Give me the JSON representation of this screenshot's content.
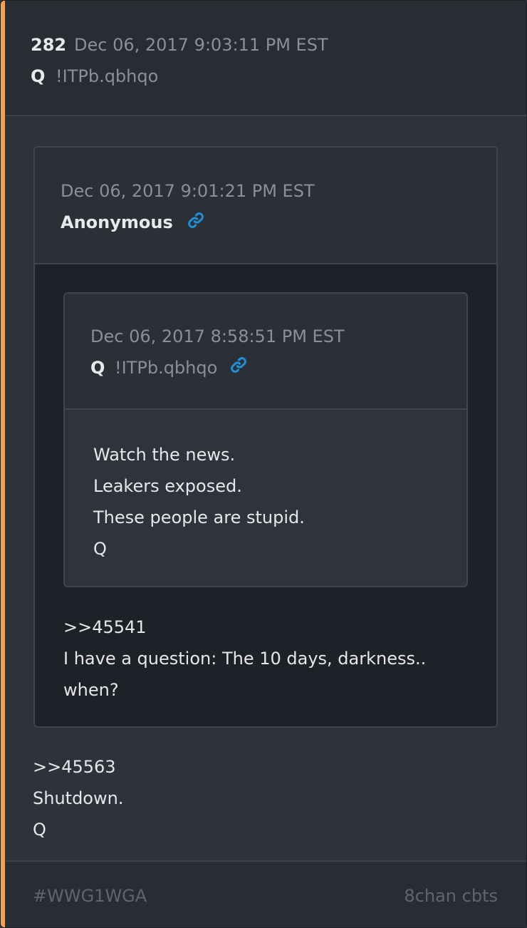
{
  "post": {
    "number": "282",
    "timestamp": "Dec 06, 2017 9:03:11 PM EST",
    "author": "Q",
    "tripcode": "!ITPb.qbhqo",
    "body_lines": [
      ">>45563",
      "Shutdown.",
      "Q"
    ]
  },
  "quoted": {
    "timestamp": "Dec 06, 2017 9:01:21 PM EST",
    "author": "Anonymous",
    "link_icon": "link-icon",
    "body_lines": [
      ">>45541",
      "I have a question: The 10 days, darkness..",
      "when?"
    ],
    "nested": {
      "timestamp": "Dec 06, 2017 8:58:51 PM EST",
      "author": "Q",
      "tripcode": "!ITPb.qbhqo",
      "link_icon": "link-icon",
      "body_lines": [
        "Watch the news.",
        "Leakers exposed.",
        "These people are stupid.",
        "Q"
      ]
    }
  },
  "footer": {
    "hashtag": "#WWG1WGA",
    "source": "8chan cbts"
  },
  "colors": {
    "accent": "#f5a04b",
    "link": "#1f8fd6",
    "background": "#2e333b"
  }
}
